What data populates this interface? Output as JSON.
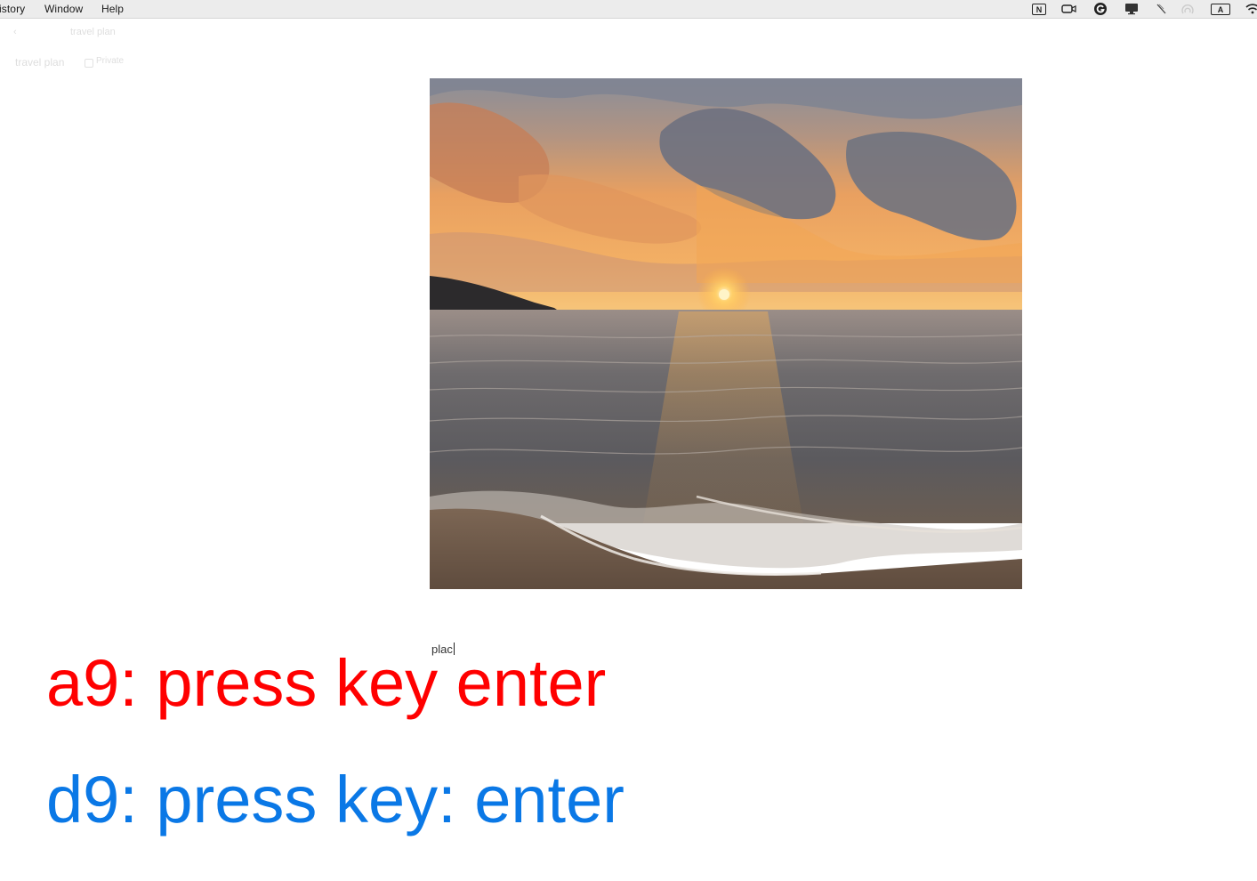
{
  "menubar": {
    "items": [
      "istory",
      "Window",
      "Help"
    ],
    "tray_icons": [
      "notion-icon",
      "zoom-icon",
      "grammarly-icon",
      "display-icon",
      "mute-icon",
      "airdrop-icon",
      "input-source-icon",
      "wifi-icon"
    ],
    "input_source_label": "A",
    "notion_label": "N"
  },
  "app_header": {
    "breadcrumb": "travel plan",
    "page_title": "travel plan",
    "shared_label": "Private"
  },
  "photo": {
    "description_icon": "beach-sunset-image"
  },
  "editor": {
    "typed_text": "plac"
  },
  "annotations": {
    "agent": "a9: press key enter",
    "demo": "d9: press key: enter",
    "agent_color": "#ff0000",
    "demo_color": "#0a78e6"
  }
}
